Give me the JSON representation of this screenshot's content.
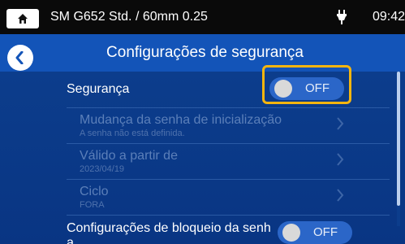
{
  "status": {
    "title": "SM G652 Std. / 60mm 0.25",
    "time": "09:42",
    "home_icon": "home-icon",
    "power_icon": "plug-icon"
  },
  "header": {
    "title": "Configurações de segurança",
    "back_icon": "chevron-left-icon"
  },
  "settings": {
    "security": {
      "label": "Segurança",
      "toggle": "OFF"
    },
    "items": [
      {
        "label": "Mudança da senha de inicialização",
        "sub": "A senha não está definida."
      },
      {
        "label": "Válido a partir de",
        "sub": "2023/04/19"
      },
      {
        "label": "Ciclo",
        "sub": "FORA"
      }
    ],
    "lock": {
      "label_line1": "Configurações de bloqueio da senh",
      "label_line2": "a",
      "toggle": "OFF"
    }
  },
  "colors": {
    "status_bg": "#0a0a0a",
    "header_bg": "#1354b8",
    "content_bg": "#0c3d8c",
    "toggle_off": "#2b66c8",
    "highlight": "#f5b50f"
  }
}
